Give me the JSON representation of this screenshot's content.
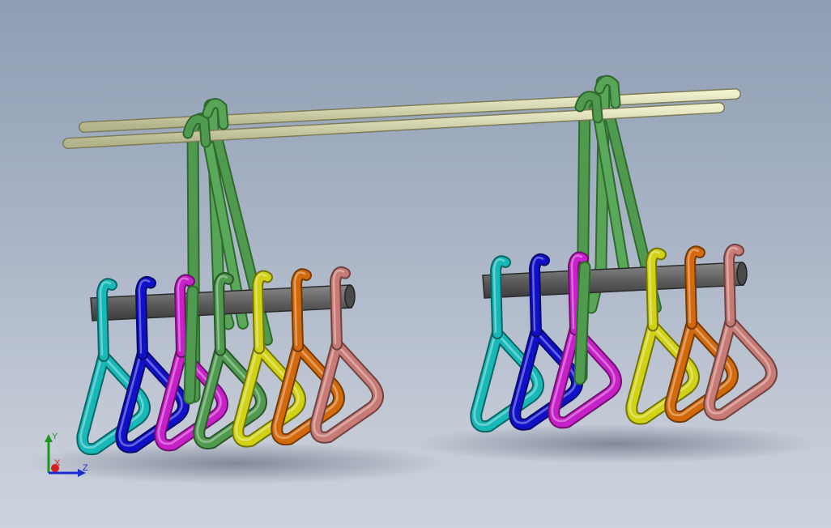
{
  "viewport": {
    "background_top": "#8f9db3",
    "background_bottom": "#cdd3dd"
  },
  "triad": {
    "x_label": "X",
    "y_label": "Y",
    "z_label": "Z",
    "x_color": "#d42020",
    "y_color": "#1a9a1a",
    "z_color": "#1a2ed0"
  },
  "model": {
    "rod_color": "#d6d6a6",
    "bar_color": "#5e5e5e",
    "hook_color": "#4f9a4f",
    "hanger_colors": [
      "#17b8b8",
      "#1010c8",
      "#c820c8",
      "#4f9a4f",
      "#d2d214",
      "#d26a0c",
      "#c87a74"
    ]
  }
}
